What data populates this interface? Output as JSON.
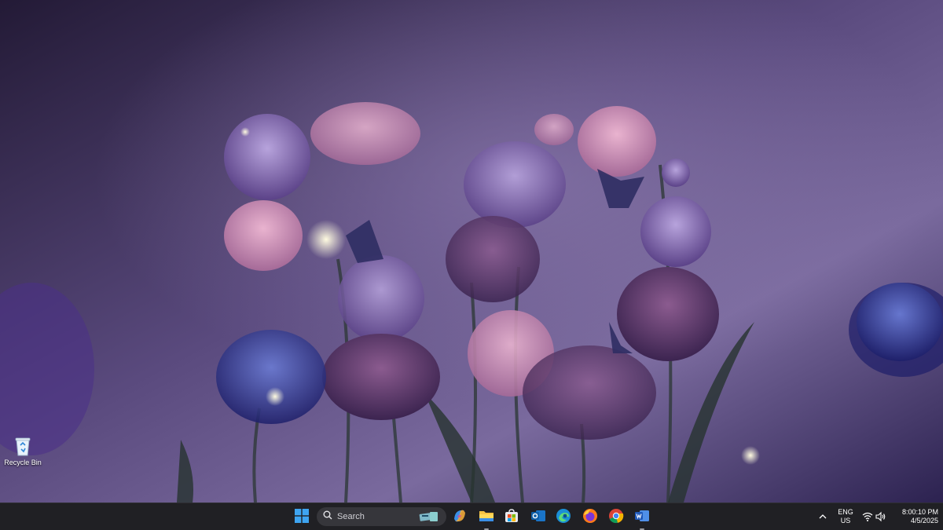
{
  "desktop": {
    "icons": [
      {
        "label": "Recycle Bin",
        "icon": "recycle-bin-icon"
      }
    ]
  },
  "taskbar": {
    "search": {
      "placeholder": "Search"
    },
    "apps": [
      {
        "name": "start",
        "icon": "windows-logo-icon"
      },
      {
        "name": "copilot",
        "icon": "copilot-icon"
      },
      {
        "name": "file-explorer",
        "icon": "folder-icon"
      },
      {
        "name": "microsoft-store",
        "icon": "store-icon"
      },
      {
        "name": "outlook",
        "icon": "outlook-icon"
      },
      {
        "name": "edge",
        "icon": "edge-icon"
      },
      {
        "name": "firefox",
        "icon": "firefox-icon"
      },
      {
        "name": "chrome",
        "icon": "chrome-icon"
      },
      {
        "name": "word",
        "icon": "word-icon"
      }
    ],
    "tray": {
      "lang_line1": "ENG",
      "lang_line2": "US",
      "time": "8:00:10 PM",
      "date": "4/5/2025"
    }
  },
  "colors": {
    "taskbar_bg": "#202024",
    "wallpaper_base": "#3a2c55",
    "accent_blue": "#0078d4"
  }
}
